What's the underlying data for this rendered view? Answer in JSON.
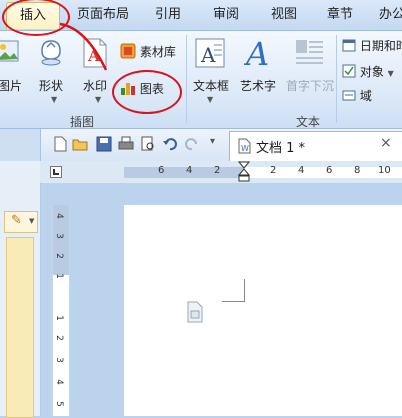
{
  "menu": {
    "tabs": [
      {
        "label": "插入",
        "active": true
      },
      {
        "label": "页面布局"
      },
      {
        "label": "引用"
      },
      {
        "label": "审阅"
      },
      {
        "label": "视图"
      },
      {
        "label": "章节"
      },
      {
        "label": "办公"
      }
    ]
  },
  "ribbon": {
    "picture_label": "图片",
    "shape_label": "形状",
    "watermark_label": "水印",
    "library_label": "素材库",
    "chart_label": "图表",
    "textbox_label": "文本框",
    "arttext_label": "艺术字",
    "dropcap_label": "首字下沉",
    "datetime_label": "日期和时",
    "object_label": "对象",
    "field_label": "域",
    "group_illustrations": "插图",
    "group_text": "文本"
  },
  "document_tab": {
    "title": "文档 1 *"
  },
  "ruler": {
    "ticks": [
      "6",
      "4",
      "2",
      "2",
      "4",
      "6",
      "8",
      "10"
    ]
  },
  "vruler": {
    "ticks": [
      "4",
      "3",
      "2",
      "1",
      "1",
      "2",
      "3",
      "4",
      "5"
    ]
  },
  "annotation_color": "#d8141c"
}
